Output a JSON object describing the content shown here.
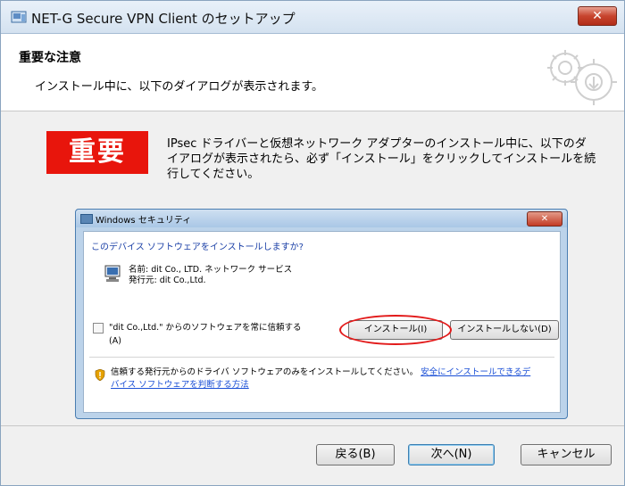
{
  "window": {
    "title": "NET-G Secure VPN Client のセットアップ",
    "close_glyph": "✕"
  },
  "banner": {
    "heading": "重要な注意",
    "subheading": "インストール中に、以下のダイアログが表示されます。"
  },
  "content": {
    "important_label": "重要",
    "notice_lines": [
      "IPsec ドライバーと仮想ネットワーク アダプターのインストール中に、以下のダ",
      "イアログが表示されたら、必ず「インストール」をクリックしてインストールを続",
      "行してください。"
    ]
  },
  "inner_dialog": {
    "title": "Windows セキュリティ",
    "close_glyph": "✕",
    "question": "このデバイス ソフトウェアをインストールしますか?",
    "name_line": "名前: dit Co., LTD. ネットワーク サービス",
    "publisher_line": "発行元: dit Co.,Ltd.",
    "trust_lines": [
      "\"dit Co.,Ltd.\" からのソフトウェアを常に信頼する",
      "(A)"
    ],
    "install_label": "インストール(I)",
    "dont_install_label": "インストールしない(D)",
    "warning_text": "信頼する発行元からのドライバ ソフトウェアのみをインストールしてください。",
    "warning_link_1": "安全にインストールできるデ",
    "warning_link_2": "バイス ソフトウェアを判断する方法"
  },
  "footer": {
    "back_label": "戻る(B)",
    "next_label": "次へ(N)",
    "cancel_label": "キャンセル"
  }
}
